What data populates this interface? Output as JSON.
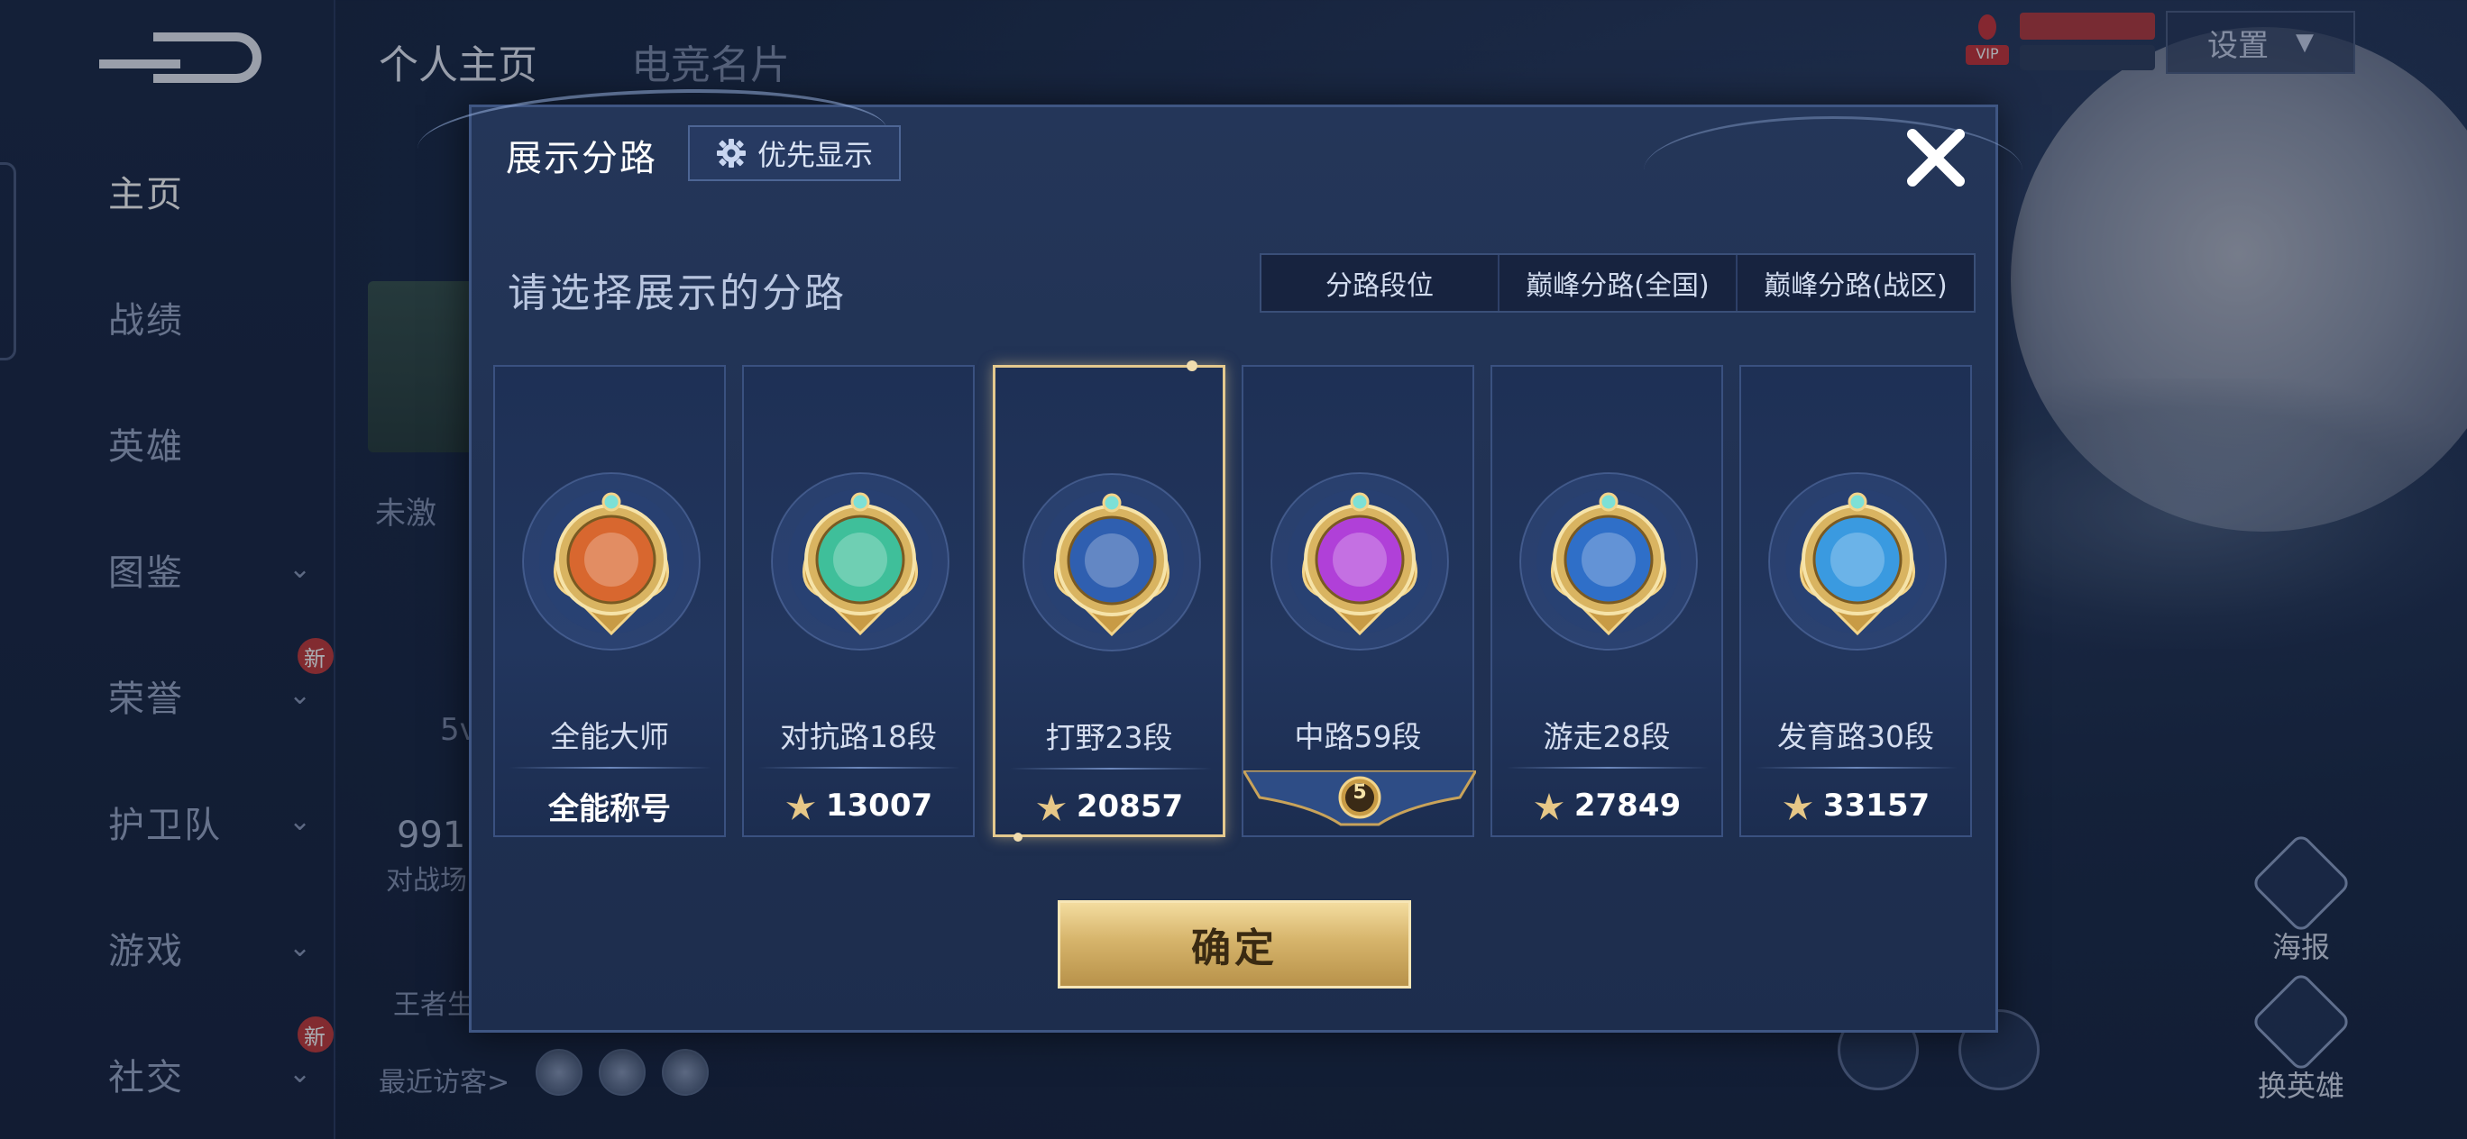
{
  "sidebar": {
    "items": [
      {
        "label": "主页",
        "active": true,
        "chevron": false,
        "new": false
      },
      {
        "label": "战绩",
        "active": false,
        "chevron": false,
        "new": false
      },
      {
        "label": "英雄",
        "active": false,
        "chevron": false,
        "new": false
      },
      {
        "label": "图鉴",
        "active": false,
        "chevron": true,
        "new": false
      },
      {
        "label": "荣誉",
        "active": false,
        "chevron": true,
        "new": true
      },
      {
        "label": "护卫队",
        "active": false,
        "chevron": true,
        "new": false
      },
      {
        "label": "游戏",
        "active": false,
        "chevron": true,
        "new": false
      },
      {
        "label": "社交",
        "active": false,
        "chevron": true,
        "new": true
      }
    ],
    "new_badge": "新"
  },
  "header": {
    "tabs": [
      {
        "label": "个人主页"
      },
      {
        "label": "电竞名片"
      }
    ],
    "settings_label": "设置",
    "vip_label": "VIP"
  },
  "background": {
    "status_text": "未激",
    "level_text": "5v",
    "score_text": "991",
    "score_caption": "对战场",
    "bottom_text": "王者生",
    "recent_visitors": "最近访客>",
    "poster_label": "海报",
    "change_hero_label": "换英雄"
  },
  "dialog": {
    "title": "展示分路",
    "priority_label": "优先显示",
    "subtitle": "请选择展示的分路",
    "tabs": [
      {
        "label": "分路段位",
        "active": true
      },
      {
        "label": "巅峰分路(全国)",
        "active": false
      },
      {
        "label": "巅峰分路(战区)",
        "active": false
      }
    ],
    "cards": [
      {
        "name": "全能大师",
        "footer": "全能称号",
        "footer_type": "text",
        "badge_color": "#d8672f",
        "selected": false,
        "icon": "allround-badge-icon"
      },
      {
        "name": "对抗路18段",
        "footer": "13007",
        "footer_type": "score",
        "badge_color": "#3fbf9a",
        "selected": false,
        "icon": "clash-lane-badge-icon"
      },
      {
        "name": "打野23段",
        "footer": "20857",
        "footer_type": "score",
        "badge_color": "#2f5fb0",
        "selected": true,
        "icon": "jungle-badge-icon"
      },
      {
        "name": "中路59段",
        "footer": "5",
        "footer_type": "rank",
        "badge_color": "#b040d8",
        "selected": false,
        "icon": "mid-lane-badge-icon"
      },
      {
        "name": "游走28段",
        "footer": "27849",
        "footer_type": "score",
        "badge_color": "#2f6fc8",
        "selected": false,
        "icon": "roam-badge-icon"
      },
      {
        "name": "发育路30段",
        "footer": "33157",
        "footer_type": "score",
        "badge_color": "#3a9ae0",
        "selected": false,
        "icon": "farm-lane-badge-icon"
      }
    ],
    "confirm_label": "确定"
  }
}
